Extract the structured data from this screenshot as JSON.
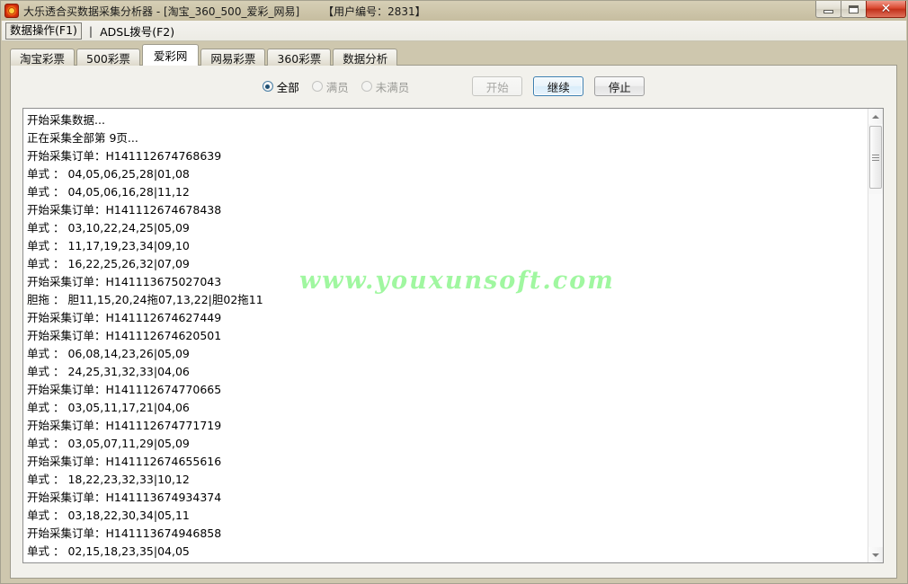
{
  "window": {
    "title_main": "大乐透合买数据采集分析器 - [淘宝_360_500_爱彩_网易]",
    "title_user": "【用户编号：2831】",
    "app_icon": "lottery-app-icon",
    "buttons": {
      "minimize": "minimize-icon",
      "maximize": "maximize-icon",
      "close": "✕"
    }
  },
  "menubar": {
    "data_ops": "数据操作(F1)",
    "separator": "|",
    "adsl": "ADSL拨号(F2)"
  },
  "tabs": [
    {
      "label": "淘宝彩票",
      "active": false
    },
    {
      "label": "500彩票",
      "active": false
    },
    {
      "label": "爱彩网",
      "active": true
    },
    {
      "label": "网易彩票",
      "active": false
    },
    {
      "label": "360彩票",
      "active": false
    },
    {
      "label": "数据分析",
      "active": false
    }
  ],
  "controls": {
    "radios": [
      {
        "label": "全部",
        "checked": true,
        "enabled": true
      },
      {
        "label": "满员",
        "checked": false,
        "enabled": false
      },
      {
        "label": "未满员",
        "checked": false,
        "enabled": false
      }
    ],
    "buttons": [
      {
        "label": "开始",
        "state": "disabled"
      },
      {
        "label": "继续",
        "state": "focused"
      },
      {
        "label": "停止",
        "state": "normal"
      }
    ]
  },
  "watermark": "www.youxunsoft.com",
  "log": {
    "lines": [
      "开始采集数据...",
      "正在采集全部第 9页...",
      "开始采集订单：H141112674768639",
      "单式 ： 04,05,06,25,28|01,08",
      "单式 ： 04,05,06,16,28|11,12",
      "开始采集订单：H141112674678438",
      "单式 ： 03,10,22,24,25|05,09",
      "单式 ： 11,17,19,23,34|09,10",
      "单式 ： 16,22,25,26,32|07,09",
      "开始采集订单：H141113675027043",
      "胆拖 ： 胆11,15,20,24拖07,13,22|胆02拖11",
      "开始采集订单：H141112674627449",
      "开始采集订单：H141112674620501",
      "单式 ： 06,08,14,23,26|05,09",
      "单式 ： 24,25,31,32,33|04,06",
      "开始采集订单：H141112674770665",
      "单式 ： 03,05,11,17,21|04,06",
      "开始采集订单：H141112674771719",
      "单式 ： 03,05,07,11,29|05,09",
      "开始采集订单：H141112674655616",
      "单式 ： 18,22,23,32,33|10,12",
      "开始采集订单：H141113674934374",
      "单式 ： 03,18,22,30,34|05,11",
      "开始采集订单：H141113674946858",
      "单式 ： 02,15,18,23,35|04,05"
    ]
  },
  "scrollbar": {
    "up_arrow": "scroll-up-icon",
    "down_arrow": "scroll-down-icon"
  }
}
